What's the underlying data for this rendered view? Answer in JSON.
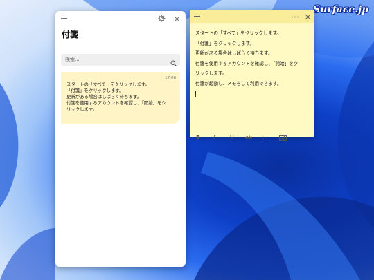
{
  "watermark": "Surface.jp",
  "notes_list": {
    "title": "付箋",
    "search": {
      "placeholder": "検索..."
    },
    "note": {
      "time": "17:06",
      "lines": [
        "スタートの「すべて」をクリックします。",
        "「付箋」をクリックします。",
        "更新がある場合はしばらく待ちます。",
        "付箋を使用するアカウントを確認し、「開始」をク",
        "リックします。"
      ]
    }
  },
  "sticky_note": {
    "lines": [
      "スタートの「すべて」をクリックします。",
      "「付箋」をクリックします。",
      "更新がある場合はしばらく待ちます。",
      "付箋を使用するアカウントを確認し、「開始」をク",
      "リックします。",
      "付箋が起動し、メモをして利用できます。"
    ],
    "toolbar": {
      "bold": "B",
      "italic": "I",
      "underline": "U",
      "strikethrough": "ab"
    }
  },
  "icons": {
    "add": "plus-icon",
    "settings": "gear-icon",
    "close": "close-icon",
    "search": "search-icon",
    "menu": "more-icon",
    "bullets": "bullet-list-icon",
    "image": "image-icon"
  },
  "colors": {
    "note_yellow": "#fff9c4",
    "note_titlebar": "#f9ed9a",
    "note_card": "#fff4c6",
    "wallpaper_blue": "#0d3fc6"
  }
}
